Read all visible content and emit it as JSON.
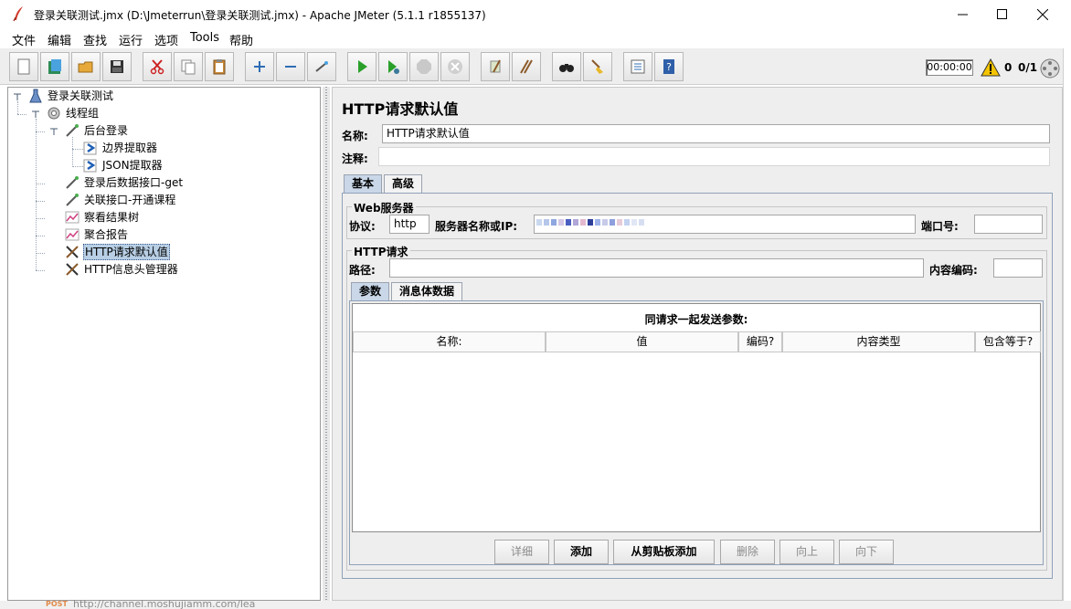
{
  "window": {
    "title": "登录关联测试.jmx (D:\\Jmeterrun\\登录关联测试.jmx) - Apache JMeter (5.1.1 r1855137)"
  },
  "menu": [
    "文件",
    "编辑",
    "查找",
    "运行",
    "选项",
    "Tools",
    "帮助"
  ],
  "toolbar": {
    "buttons": [
      "new",
      "templates",
      "open",
      "save",
      "cut",
      "copy",
      "paste",
      "expand",
      "collapse",
      "toggle",
      "start",
      "start-no-pause",
      "stop",
      "shutdown",
      "clear",
      "clear-all",
      "search",
      "reset-search",
      "function-helper",
      "help"
    ],
    "timer": "00:00:00",
    "warnings": "0",
    "threads": "0/1"
  },
  "tree": {
    "items": [
      {
        "label": "登录关联测试",
        "icon": "test-plan-icon",
        "level": 0
      },
      {
        "label": "线程组",
        "icon": "thread-group-icon",
        "level": 1
      },
      {
        "label": "后台登录",
        "icon": "sampler-icon",
        "level": 2
      },
      {
        "label": "边界提取器",
        "icon": "extractor-icon",
        "level": 3
      },
      {
        "label": "JSON提取器",
        "icon": "extractor-icon",
        "level": 3
      },
      {
        "label": "登录后数据接口-get",
        "icon": "sampler-icon",
        "level": 2
      },
      {
        "label": "关联接口-开通课程",
        "icon": "sampler-icon",
        "level": 2
      },
      {
        "label": "察看结果树",
        "icon": "listener-icon",
        "level": 2
      },
      {
        "label": "聚合报告",
        "icon": "listener-icon",
        "level": 2
      },
      {
        "label": "HTTP请求默认值",
        "icon": "config-icon",
        "level": 2,
        "selected": true
      },
      {
        "label": "HTTP信息头管理器",
        "icon": "config-icon",
        "level": 2
      }
    ]
  },
  "panel": {
    "title": "HTTP请求默认值",
    "name_label": "名称:",
    "name_value": "HTTP请求默认值",
    "comment_label": "注释:",
    "comment_value": "",
    "tabs": [
      "基本",
      "高级"
    ],
    "web_server": {
      "group_title": "Web服务器",
      "protocol_label": "协议:",
      "protocol_value": "http",
      "server_label": "服务器名称或IP:",
      "server_value": "",
      "port_label": "端口号:",
      "port_value": ""
    },
    "http_request": {
      "group_title": "HTTP请求",
      "path_label": "路径:",
      "path_value": "",
      "encoding_label": "内容编码:",
      "encoding_value": ""
    },
    "sub_tabs": [
      "参数",
      "消息体数据"
    ],
    "params_table": {
      "caption": "同请求一起发送参数:",
      "columns": [
        "名称:",
        "值",
        "编码?",
        "内容类型",
        "包含等于?"
      ]
    },
    "buttons": {
      "detail": "详细",
      "add": "添加",
      "add_from_clipboard": "从剪贴板添加",
      "delete": "删除",
      "up": "向上",
      "down": "向下"
    }
  },
  "background": {
    "method": "POST",
    "url": "http://channel.moshujiamm.com/lea"
  }
}
